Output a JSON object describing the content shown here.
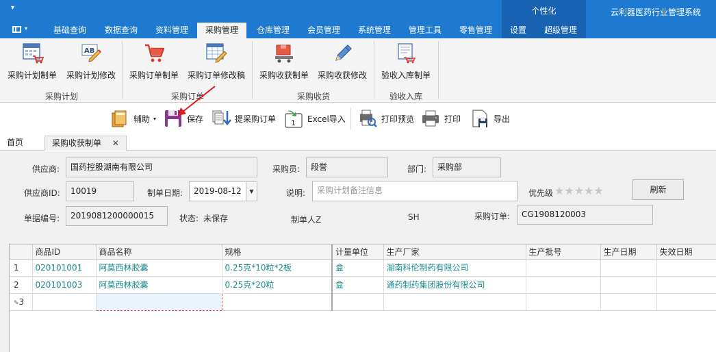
{
  "window": {
    "quick_access": "▾",
    "personal_label": "个性化",
    "app_title": "云利器医药行业管理系统"
  },
  "menu_tabs": [
    {
      "label": "基础查询"
    },
    {
      "label": "数据查询"
    },
    {
      "label": "资料管理"
    },
    {
      "label": "采购管理"
    },
    {
      "label": "仓库管理"
    },
    {
      "label": "会员管理"
    },
    {
      "label": "系统管理"
    },
    {
      "label": "管理工具"
    },
    {
      "label": "零售管理"
    },
    {
      "label": "设置"
    },
    {
      "label": "超级管理"
    }
  ],
  "ribbon": {
    "buttons": [
      {
        "label": "采购计划制单",
        "icon": "calendar-cart-icon"
      },
      {
        "label": "采购计划修改",
        "icon": "ab-edit-icon"
      },
      {
        "label": "采购订单制单",
        "icon": "shopping-cart-icon"
      },
      {
        "label": "采购订单修改稿",
        "icon": "table-edit-icon"
      },
      {
        "label": "采购收获制单",
        "icon": "truck-box-icon"
      },
      {
        "label": "采购收获修改",
        "icon": "pencil-icon"
      },
      {
        "label": "验收入库制单",
        "icon": "stock-in-icon"
      }
    ],
    "groups": [
      {
        "label": "采购计划"
      },
      {
        "label": "采购订单"
      },
      {
        "label": "采购收货"
      },
      {
        "label": "验收入库"
      }
    ]
  },
  "toolbar": {
    "assist": "辅助",
    "save": "保存",
    "fetch_order": "提采购订单",
    "excel_import": "Excel导入",
    "print_preview": "打印预览",
    "print": "打印",
    "export": "导出"
  },
  "doc_tabs": {
    "home": "首页",
    "current": "采购收获制单",
    "close": "✕"
  },
  "form": {
    "supplier_label": "供应商:",
    "supplier_value": "国药控股湖南有限公司",
    "buyer_label": "采购员:",
    "buyer_value": "段誉",
    "dept_label": "部门:",
    "dept_value": "采购部",
    "supplier_id_label": "供应商ID:",
    "supplier_id_value": "10019",
    "date_label": "制单日期:",
    "date_value": "2019-08-12",
    "note_label": "说明:",
    "note_placeholder": "采购计划备注信息",
    "priority_label": "优先级",
    "stars": "★★★★★",
    "refresh_label": "刷新",
    "doc_no_label": "单据编号:",
    "doc_no_value": "2019081200000015",
    "status_label": "状态:",
    "status_value": "未保存",
    "maker_label": "制单人Z",
    "maker_value": "SH",
    "order_label": "采购订单:",
    "order_value": "CG1908120003"
  },
  "grid": {
    "columns": [
      "商品ID",
      "商品名称",
      "规格",
      "计量单位",
      "生产厂家",
      "生产批号",
      "生产日期",
      "失效日期"
    ],
    "rows": [
      {
        "no": "1",
        "cells": [
          "020101001",
          "阿莫西林胶囊",
          "0.25克*10粒*2板",
          "盒",
          "湖南科伦制药有限公司",
          "",
          "",
          ""
        ]
      },
      {
        "no": "2",
        "cells": [
          "020101003",
          "阿莫西林胶囊",
          "0.25克*20粒",
          "盒",
          "通药制药集团股份有限公司",
          "",
          "",
          ""
        ]
      }
    ],
    "new_row_no": "3"
  }
}
